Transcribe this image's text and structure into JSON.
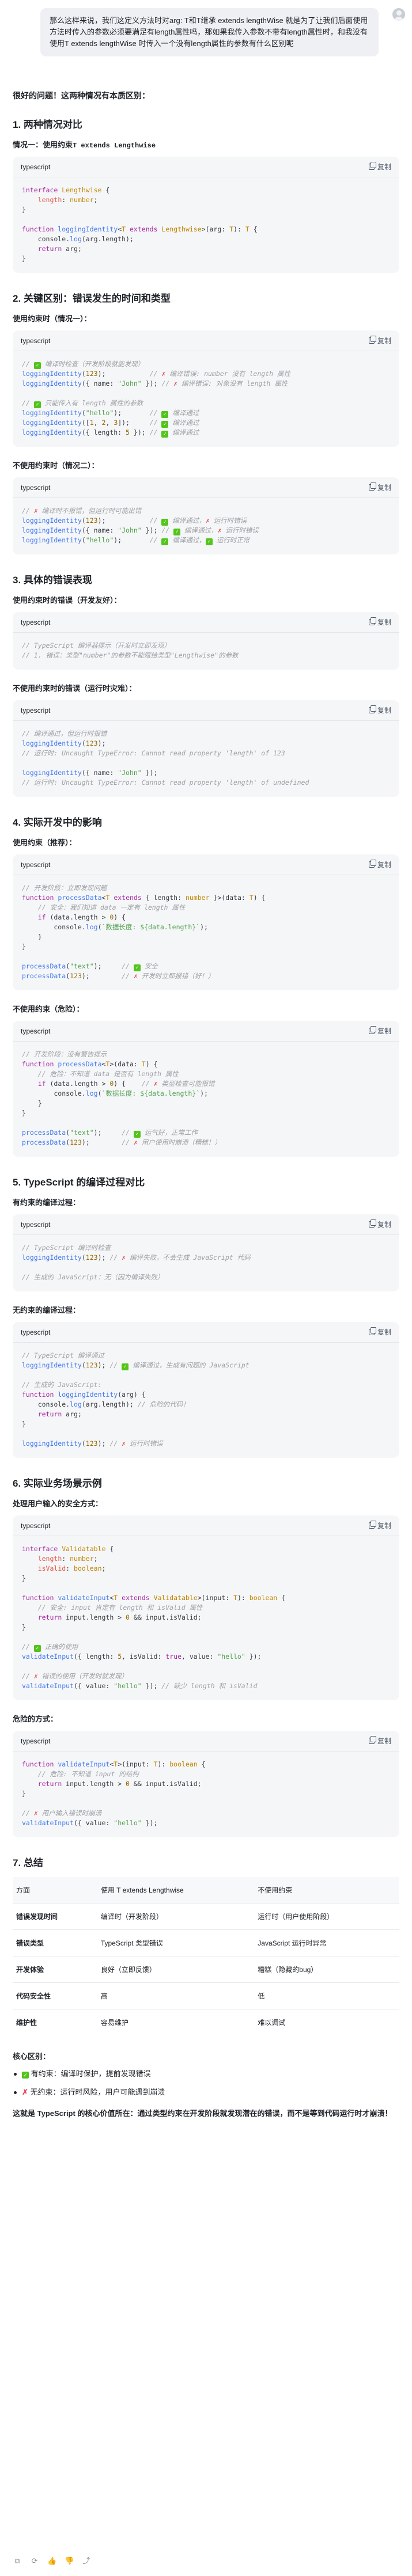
{
  "user_message": "那么这样来说，我们这定义方法时对arg: T和T继承 extends lengthWise 就是为了让我们后面使用方法时传入的参数必须要满足有length属性吗，那如果我传入参数不带有length属性时，和我没有使用T extends lengthWise 时传入一个没有length属性的参数有什么区别呢",
  "intro": "很好的问题！这两种情况有本质区别：",
  "sec1": {
    "title": "1. 两种情况对比",
    "case1_label": "情况一：使用约束",
    "case1_code": "T extends Lengthwise"
  },
  "sec2": {
    "title": "2. 关键区别：错误发生的时间和类型",
    "sub1": "使用约束时（情况一）：",
    "sub2": "不使用约束时（情况二）："
  },
  "sec3": {
    "title": "3. 具体的错误表现",
    "sub1": "使用约束时的错误（开发友好）：",
    "sub2": "不使用约束时的错误（运行时灾难）："
  },
  "sec4": {
    "title": "4. 实际开发中的影响",
    "sub1": "使用约束（推荐）：",
    "sub2": "不使用约束（危险）："
  },
  "sec5": {
    "title": "5. TypeScript 的编译过程对比",
    "sub1": "有约束的编译过程：",
    "sub2": "无约束的编译过程："
  },
  "sec6": {
    "title": "6. 实际业务场景示例",
    "sub1": "处理用户输入的安全方式：",
    "sub2": "危险的方式："
  },
  "sec7": {
    "title": "7. 总结",
    "headers": [
      "方面",
      "使用 T extends Lengthwise",
      "不使用约束"
    ],
    "rows": [
      [
        "错误发现时间",
        "编译时（开发阶段）",
        "运行时（用户使用阶段）"
      ],
      [
        "错误类型",
        "TypeScript 类型错误",
        "JavaScript 运行时异常"
      ],
      [
        "开发体验",
        "良好（立即反馈）",
        "糟糕（隐藏的bug）"
      ],
      [
        "代码安全性",
        "高",
        "低"
      ],
      [
        "维护性",
        "容易维护",
        "难以调试"
      ]
    ]
  },
  "core": {
    "title": "核心区别：",
    "items": [
      "有约束：编译时保护，提前发现错误",
      "无约束：运行时风险，用户可能遇到崩溃"
    ],
    "conclusion": "这就是 TypeScript 的核心价值所在：通过类型约束在开发阶段就发现潜在的错误，而不是等到代码运行时才崩溃！"
  },
  "code_lang": "typescript",
  "copy_label": "复制"
}
